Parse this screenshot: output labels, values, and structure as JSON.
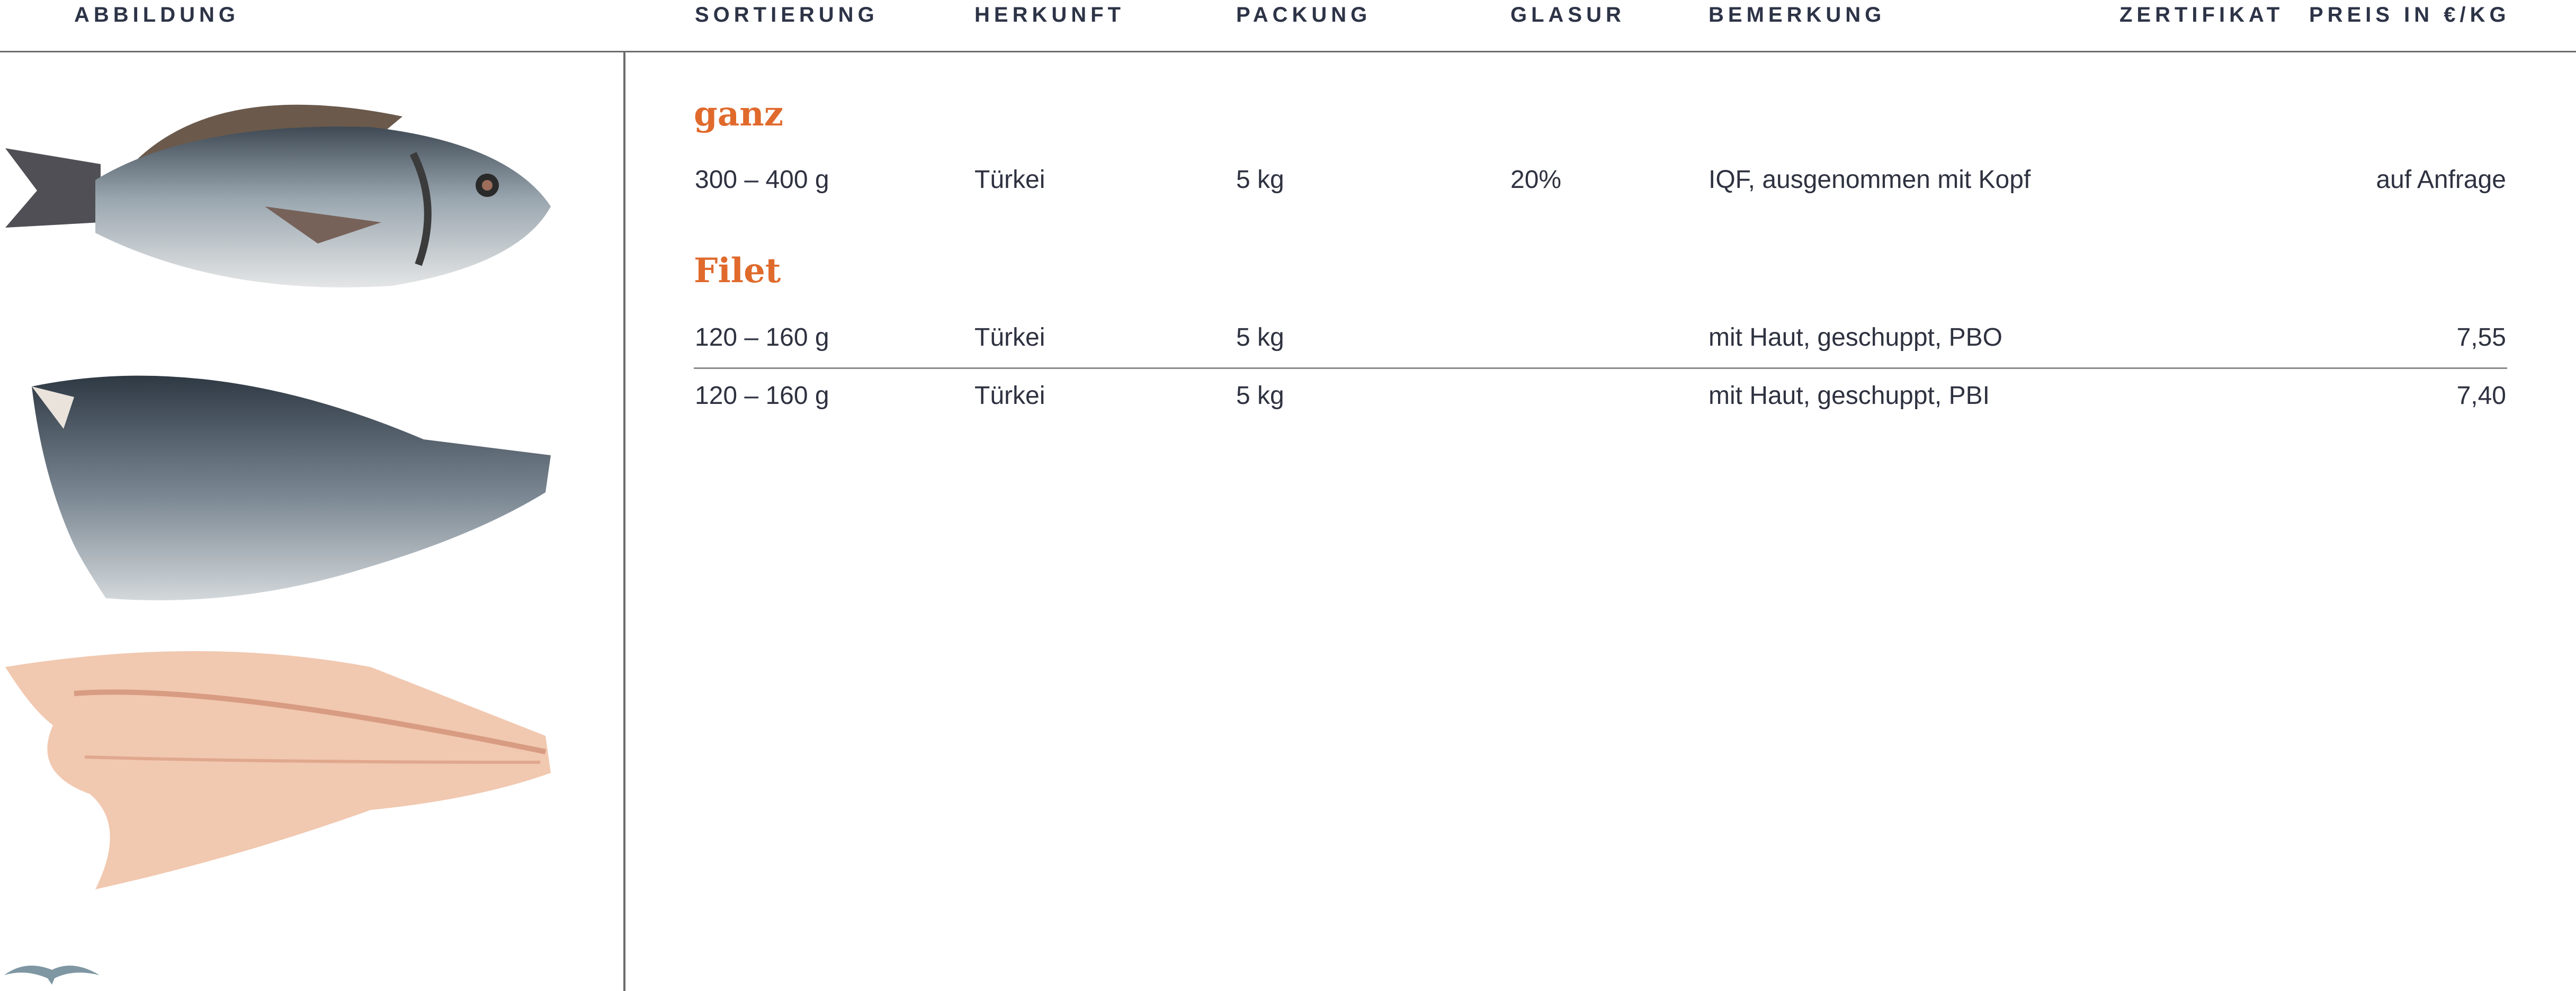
{
  "headers": {
    "abbildung": "ABBILDUNG",
    "sortierung": "SORTIERUNG",
    "herkunft": "HERKUNFT",
    "packung": "PACKUNG",
    "glasur": "GLASUR",
    "bemerkung": "BEMERKUNG",
    "zertifikat": "ZERTIFIKAT",
    "preis": "PREIS IN €/KG"
  },
  "sections": [
    {
      "title": "ganz",
      "rows": [
        {
          "sortierung": "300 – 400 g",
          "herkunft": "Türkei",
          "packung": "5 kg",
          "glasur": "20%",
          "bemerkung": "IQF, ausgenommen mit Kopf",
          "zertifikat": "",
          "preis": "auf Anfrage"
        }
      ]
    },
    {
      "title": "Filet",
      "rows": [
        {
          "sortierung": "120 – 160 g",
          "herkunft": "Türkei",
          "packung": "5 kg",
          "glasur": "",
          "bemerkung": "mit Haut, geschuppt, PBO",
          "zertifikat": "",
          "preis": "7,55"
        },
        {
          "sortierung": "120 – 160 g",
          "herkunft": "Türkei",
          "packung": "5 kg",
          "glasur": "",
          "bemerkung": "mit Haut, geschuppt, PBI",
          "zertifikat": "",
          "preis": "7,40"
        }
      ]
    }
  ],
  "images": [
    "whole-dorade-image",
    "fillet-skin-side-image",
    "fillet-flesh-side-image"
  ],
  "colors": {
    "accent": "#e06a2c",
    "text": "#2e3240",
    "rule": "#6c6c6c",
    "logo": "#7f97a3"
  }
}
